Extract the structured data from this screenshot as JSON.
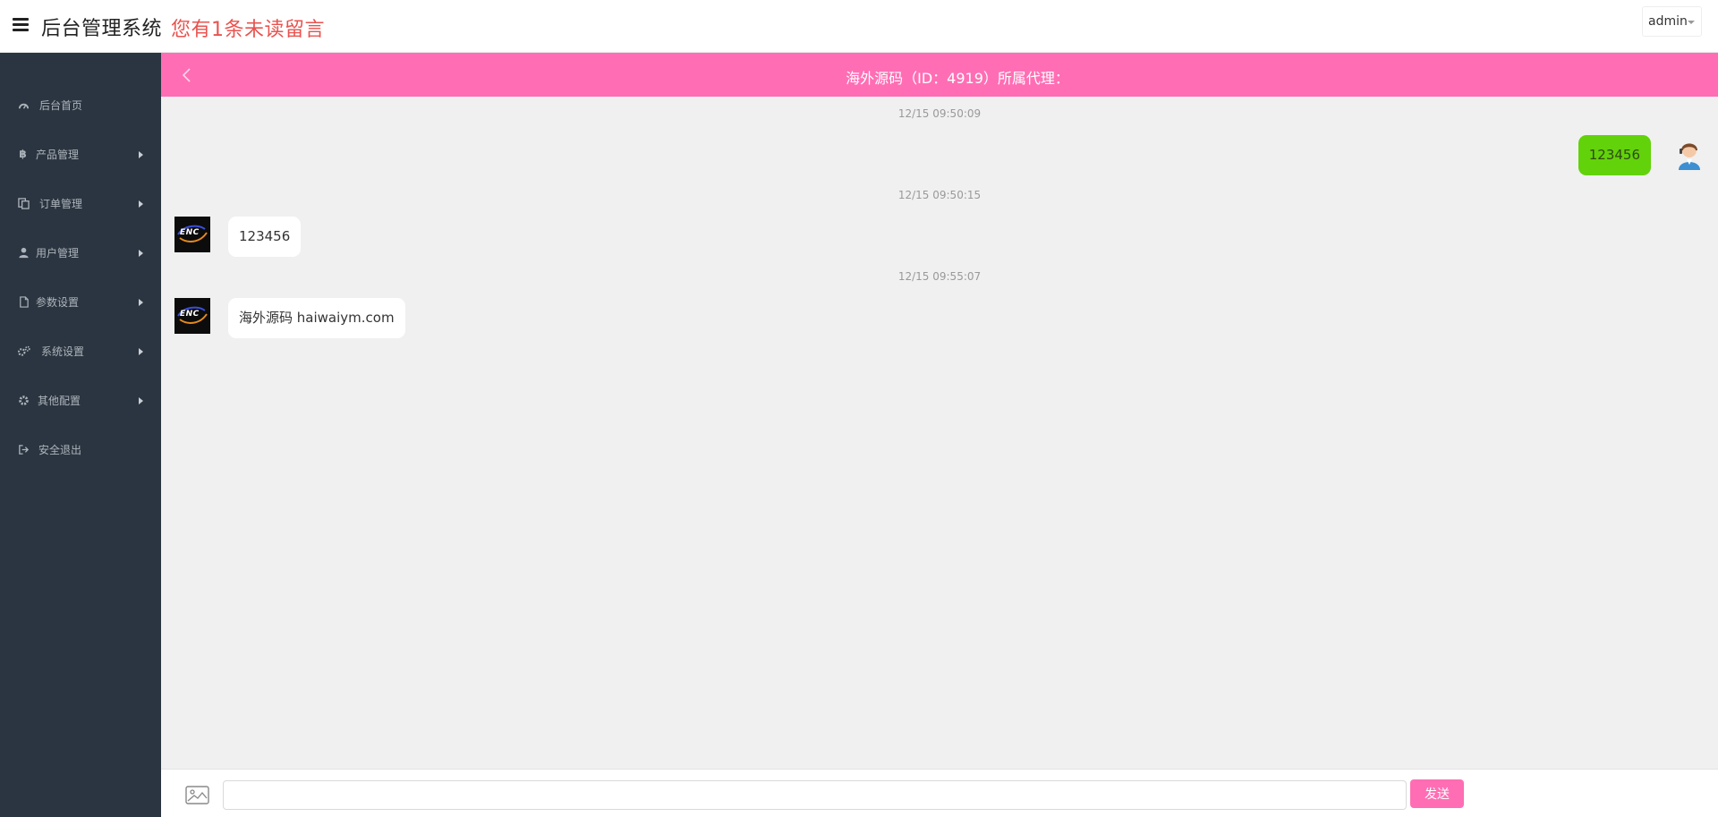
{
  "header": {
    "title": "后台管理系统",
    "notice": "您有1条未读留言",
    "user": "admin"
  },
  "sidebar": {
    "items": [
      {
        "label": "后台首页",
        "icon": "dashboard-icon",
        "has_arrow": false
      },
      {
        "label": "产品管理",
        "icon": "bitcoin-icon",
        "has_arrow": true
      },
      {
        "label": "订单管理",
        "icon": "files-icon",
        "has_arrow": true
      },
      {
        "label": "用户管理",
        "icon": "user-icon",
        "has_arrow": true
      },
      {
        "label": "参数设置",
        "icon": "file-icon",
        "has_arrow": true
      },
      {
        "label": "系统设置",
        "icon": "gears-icon",
        "has_arrow": true
      },
      {
        "label": "其他配置",
        "icon": "gear-icon",
        "has_arrow": true
      },
      {
        "label": "安全退出",
        "icon": "sign-out-icon",
        "has_arrow": false
      }
    ]
  },
  "chat": {
    "title": "海外源码（ID：4919）所属代理：",
    "messages": [
      {
        "time": "12/15 09:50:09",
        "text": "123456",
        "direction": "sent"
      },
      {
        "time": "12/15 09:50:15",
        "text": "123456",
        "direction": "received"
      },
      {
        "time": "12/15 09:55:07",
        "text": "海外源码 haiwaiym.com",
        "direction": "received"
      }
    ],
    "avatar_logo_text": "ENC"
  },
  "input_bar": {
    "placeholder": "",
    "send_label": "发送"
  },
  "colors": {
    "accent": "#ff6eb4",
    "sidebar_bg": "#2a3541",
    "sent_bubble": "#62d20a",
    "notice": "#e8534f"
  }
}
